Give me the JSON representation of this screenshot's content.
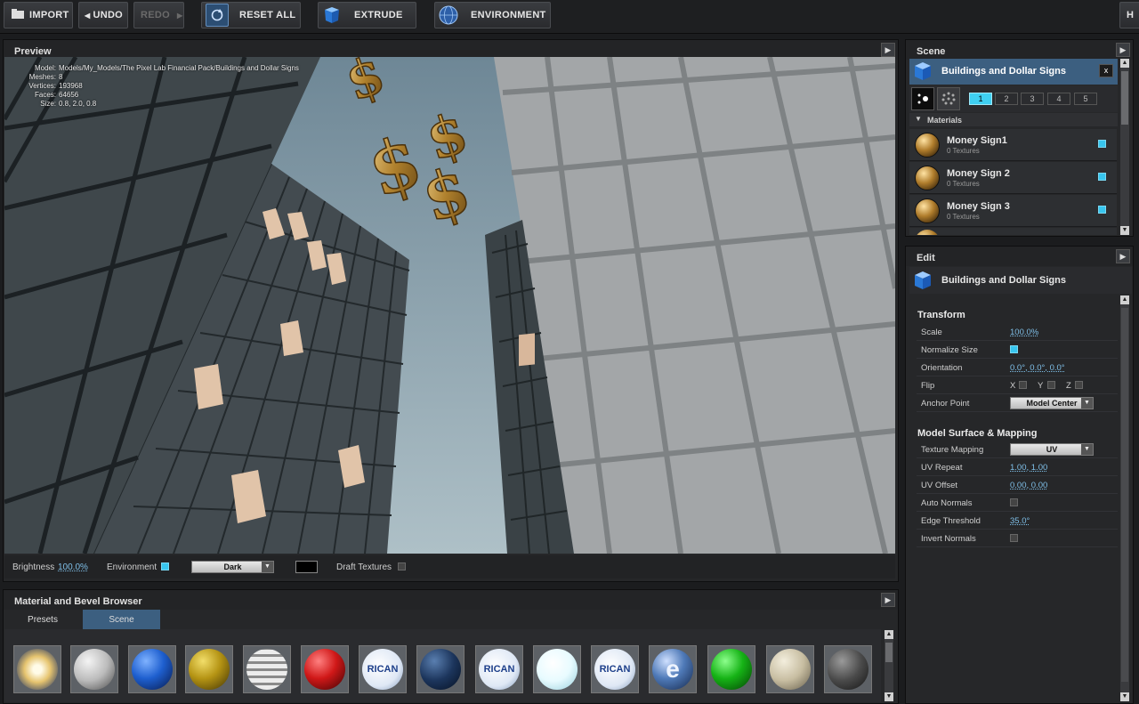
{
  "toolbar": {
    "import": "IMPORT",
    "undo": "UNDO",
    "redo": "REDO",
    "reset_all": "RESET ALL",
    "extrude": "EXTRUDE",
    "environment": "ENVIRONMENT",
    "help": "H"
  },
  "preview": {
    "title": "Preview",
    "model_info": [
      {
        "key": "Model:",
        "value": "Models/My_Models/The Pixel Lab Financial Pack/Buildings and Dollar Signs"
      },
      {
        "key": "Meshes:",
        "value": "8"
      },
      {
        "key": "Vertices:",
        "value": "193968"
      },
      {
        "key": "Faces:",
        "value": "64656"
      },
      {
        "key": "Size:",
        "value": "0.8, 2.0, 0.8"
      }
    ],
    "footer": {
      "brightness_label": "Brightness",
      "brightness_value": "100.0%",
      "environment_label": "Environment",
      "environment_on": true,
      "background_value": "Dark",
      "draft_textures_label": "Draft Textures",
      "draft_textures_on": false
    }
  },
  "browser": {
    "title": "Material and Bevel Browser",
    "tabs": [
      "Presets",
      "Scene"
    ],
    "active_tab": "Scene",
    "spheres": [
      {
        "icon": "glowing-white-sphere"
      },
      {
        "icon": "silver-sphere"
      },
      {
        "icon": "blue-sphere"
      },
      {
        "icon": "gold-sphere"
      },
      {
        "icon": "chrome-pattern-sphere"
      },
      {
        "icon": "red-sphere"
      },
      {
        "icon": "american-label-sphere",
        "text": "RICAN"
      },
      {
        "icon": "navy-sphere"
      },
      {
        "icon": "american-label-sphere",
        "text": "RICAN"
      },
      {
        "icon": "white-glass-sphere"
      },
      {
        "icon": "american-label-sphere",
        "text": "RICAN"
      },
      {
        "icon": "blue-e-logo-sphere"
      },
      {
        "icon": "green-sphere"
      },
      {
        "icon": "beige-sphere"
      },
      {
        "icon": "dark-grey-sphere"
      }
    ]
  },
  "scene": {
    "title": "Scene",
    "model_name": "Buildings and Dollar Signs",
    "close": "x",
    "pages": [
      "1",
      "2",
      "3",
      "4",
      "5"
    ],
    "active_page": "1",
    "materials_label": "Materials",
    "materials": [
      {
        "name": "Money Sign1",
        "sub": "0 Textures"
      },
      {
        "name": "Money Sign 2",
        "sub": "0 Textures"
      },
      {
        "name": "Money Sign 3",
        "sub": "0 Textures"
      }
    ]
  },
  "edit": {
    "title": "Edit",
    "model_name": "Buildings and Dollar Signs",
    "transform_label": "Transform",
    "scale_label": "Scale",
    "scale_value": "100.0%",
    "normalize_label": "Normalize Size",
    "orientation_label": "Orientation",
    "orientation_value": "0.0°, 0.0°, 0.0°",
    "flip_label": "Flip",
    "flip_x": "X",
    "flip_y": "Y",
    "flip_z": "Z",
    "anchor_label": "Anchor Point",
    "anchor_value": "Model Center",
    "surface_label": "Model Surface & Mapping",
    "texture_mapping_label": "Texture Mapping",
    "texture_mapping_value": "UV",
    "uv_repeat_label": "UV Repeat",
    "uv_repeat_value": "1.00, 1.00",
    "uv_offset_label": "UV Offset",
    "uv_offset_value": "0.00, 0.00",
    "auto_normals_label": "Auto Normals",
    "edge_threshold_label": "Edge Threshold",
    "edge_threshold_value": "35.0°",
    "invert_normals_label": "Invert Normals"
  }
}
